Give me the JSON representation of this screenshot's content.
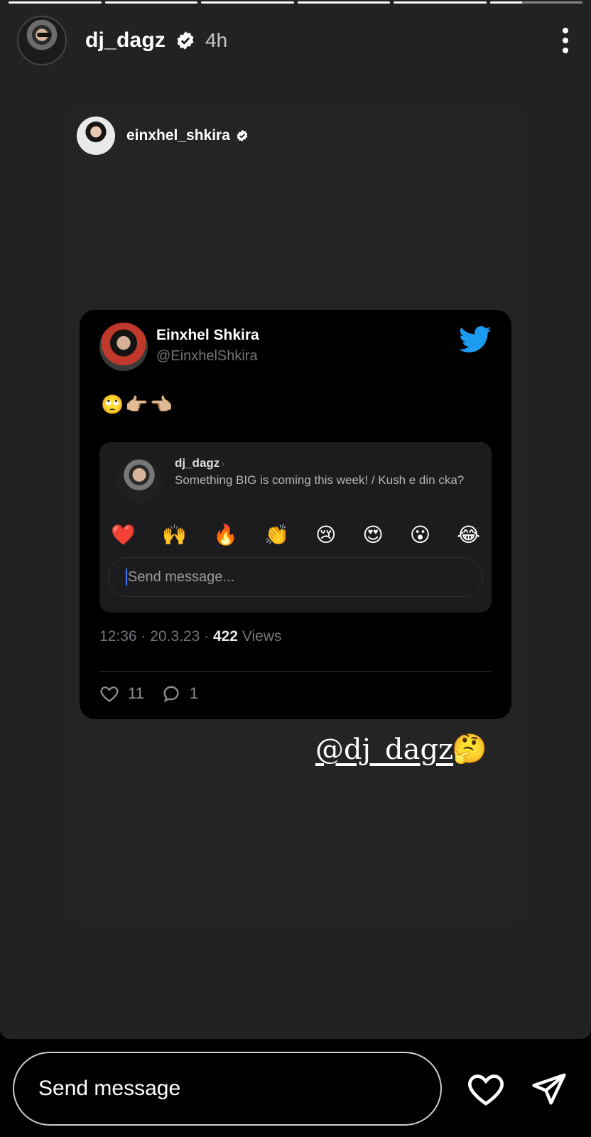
{
  "story": {
    "progress": [
      1,
      1,
      1,
      1,
      1,
      0.35
    ],
    "author": {
      "username": "dj_dagz",
      "time": "4h",
      "verified": true
    },
    "menu_icon": "more-vertical-icon"
  },
  "shared_post": {
    "username": "einxhel_shkira",
    "verified": true
  },
  "tweet": {
    "display_name": "Einxhel Shkira",
    "handle": "@EinxhelShkira",
    "platform_icon": "twitter-bird-icon",
    "text": "🙄👉🏼👈🏼",
    "embedded_dm": {
      "username": "dj_dagz",
      "chevron": "›",
      "message": "Something BIG is coming this week! / Kush e din cka?",
      "reactions": [
        "❤️",
        "🙌",
        "🔥",
        "👏",
        "😢",
        "😍",
        "😮",
        "😂"
      ],
      "input_placeholder": "Send message..."
    },
    "meta": {
      "time_date": "12:36 · 20.3.23 · ",
      "views_count": "422",
      "views_label": " Views"
    },
    "stats": {
      "likes": "11",
      "replies": "1"
    }
  },
  "caption": {
    "mention": "@dj_dagz",
    "emoji": "🤔"
  },
  "reply_bar": {
    "placeholder": "Send message",
    "like_icon": "heart-icon",
    "share_icon": "send-icon"
  },
  "colors": {
    "story_bg": "#222222",
    "tweet_bg": "#000000",
    "twitter_blue": "#1d9bf0",
    "muted": "#71767b"
  }
}
